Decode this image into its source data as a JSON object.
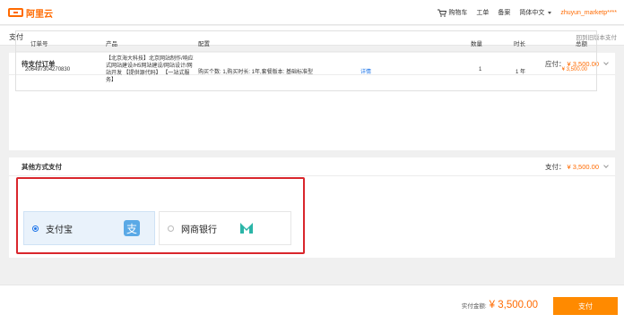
{
  "brand": {
    "name": "阿里云"
  },
  "nav": {
    "cart": "购物车",
    "ticket": "工单",
    "record": "备案",
    "lang": "简体中文",
    "user": "zhuyun_marketp****"
  },
  "page": {
    "title": "支付",
    "back_link": "回到旧版本支付"
  },
  "pending": {
    "title": "待支付订单",
    "amount_label": "应付：",
    "amount": "¥ 3,500.00",
    "headers": {
      "order_no": "订单号",
      "product": "产品",
      "config": "配置",
      "qty": "数量",
      "duration": "时长",
      "total": "总额"
    },
    "row": {
      "order_no": "206497304270830",
      "product": "【北京海大科技】北京网站制作/响应式网站建设/H5网站建设/网站设计/网站开发 【提供源代码】 【一站式服务】",
      "config": "购买个数: 1,购买时长: 1年,套餐版本: 基础标准型",
      "detail": "详情",
      "qty": "1",
      "duration": "1 年",
      "total": "¥ 3,500.00"
    }
  },
  "other": {
    "title": "其他方式支付",
    "amount_label": "支付：",
    "amount": "¥ 3,500.00",
    "options": [
      {
        "label": "支付宝",
        "icon": "alipay-icon",
        "selected": true
      },
      {
        "label": "网商银行",
        "icon": "mybank-icon",
        "selected": false
      }
    ]
  },
  "footer": {
    "amount_label": "实付金额:",
    "amount": "¥ 3,500.00",
    "pay_button": "支付"
  },
  "colors": {
    "accent": "#ff6a00",
    "pay_button": "#ff8a00",
    "highlight_border": "#d9262c",
    "alipay_blue": "#5aa9e6"
  }
}
